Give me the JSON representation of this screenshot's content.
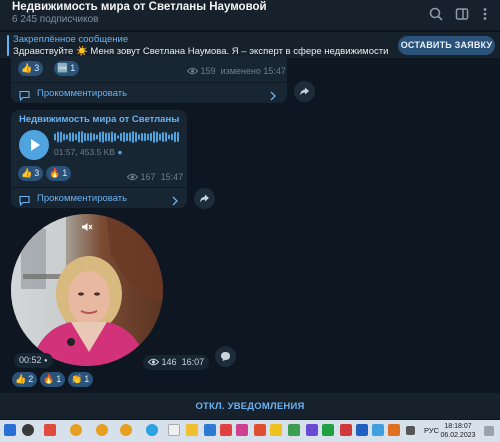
{
  "header": {
    "title": "Недвижимость мира от Светланы Наумовой",
    "subscribers": "6 245 подписчиков",
    "icons": [
      "search-icon",
      "sidebar-toggle-icon",
      "more-vertical-icon"
    ]
  },
  "pinned": {
    "title": "Закреплённое сообщение",
    "text_before_emoji": "Здравствуйте ",
    "emoji": "☀️",
    "text_after_emoji": " Меня зовут Светлана Наумова.  Я – эксперт в сфере недвижимости с опыто...",
    "button": "ОСТАВИТЬ ЗАЯВКУ"
  },
  "messages": [
    {
      "reactions": [
        {
          "emoji": "👍",
          "count": "3"
        },
        {
          "emoji": "🆒",
          "count": "1"
        }
      ],
      "views": "159",
      "edited": "изменено",
      "time": "15:47",
      "comment_label": "Прокомментировать"
    },
    {
      "title": "Недвижимость мира от Светланы Н...",
      "voice_duration": "01:57, 453.5 KB",
      "reactions": [
        {
          "emoji": "👍",
          "count": "3"
        },
        {
          "emoji": "🔥",
          "count": "1"
        }
      ],
      "views": "167",
      "time": "15:47",
      "comment_label": "Прокомментировать"
    },
    {
      "video_duration": "00:52",
      "views": "146",
      "time": "16:07",
      "reactions": [
        {
          "emoji": "👍",
          "count": "2"
        },
        {
          "emoji": "🔥",
          "count": "1"
        },
        {
          "emoji": "👏",
          "count": "1"
        }
      ]
    }
  ],
  "mute_button": "ОТКЛ. УВЕДОМЛЕНИЯ",
  "taskbar": {
    "lang": "РУС",
    "time": "18:18:07",
    "date": "06.02.2023"
  },
  "colors": {
    "background": "#0e1621",
    "panel": "#17212b",
    "bubble": "#182533",
    "accent": "#6ab3f3",
    "reaction": "#2b5278",
    "play": "#4fa4e0"
  }
}
